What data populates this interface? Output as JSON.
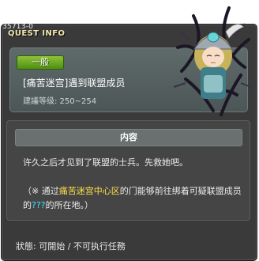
{
  "window": {
    "id_label": "35713-0",
    "title": "QUEST INFO"
  },
  "header": {
    "category": "一般",
    "quest_name": "[痛苦迷宫]遇到联盟成员",
    "level_requirement": "建議等级: 250~254"
  },
  "content": {
    "section_title": "内容",
    "description": "许久之后才见到了联盟的士兵。先救她吧。",
    "hint": {
      "prefix": "（※ 通过",
      "location": "痛苦迷宫中心区",
      "middle": "的门能够前往绑着可疑联盟成员的",
      "unknown": "???",
      "suffix": "的所在地。）"
    }
  },
  "status": "狀態: 可開始 / 不可执行任務",
  "icons": {
    "character": "character-portrait-icon"
  },
  "colors": {
    "window_bg": "#3a3a3a",
    "header_bg": "#566060",
    "badge_green": "#6aa820",
    "highlight_yellow": "#ffe14a",
    "highlight_cyan": "#3ce3ff"
  }
}
